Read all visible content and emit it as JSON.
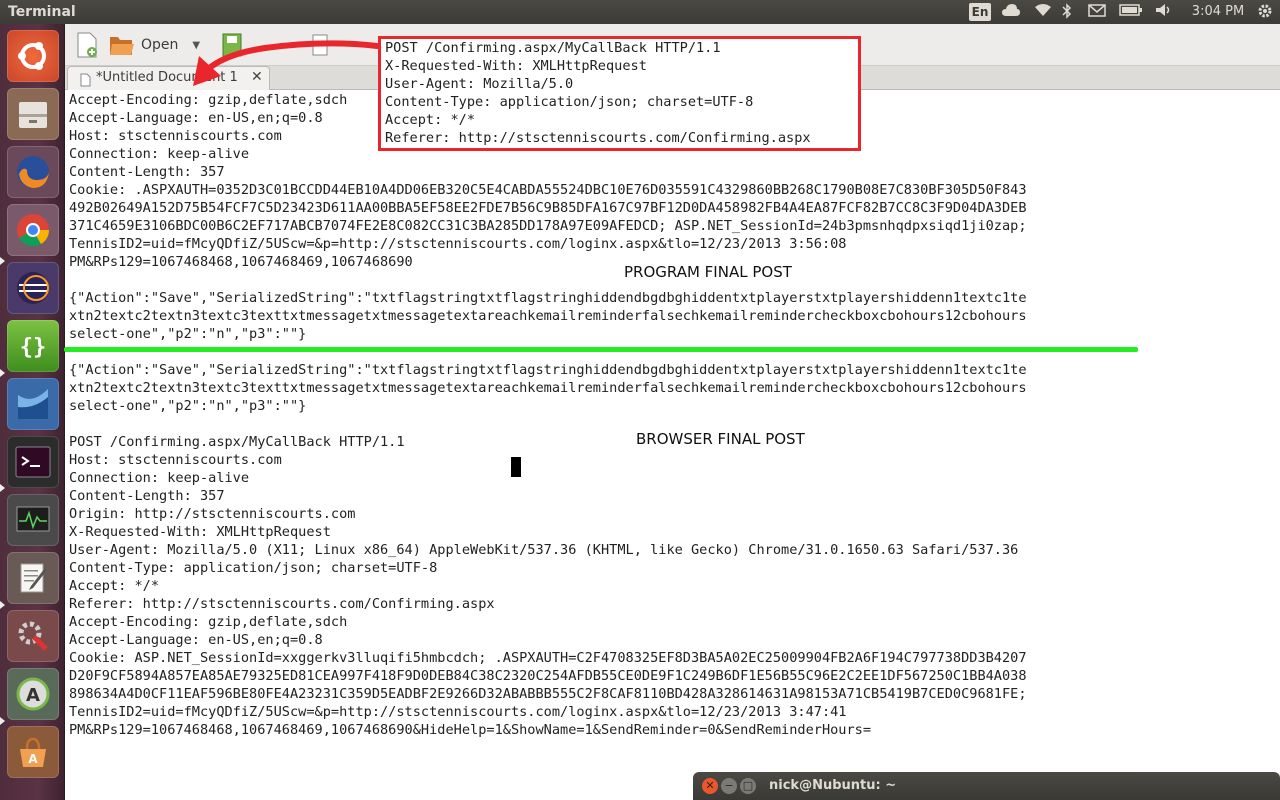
{
  "top_panel": {
    "app_title": "Terminal",
    "keyboard_indicator": "En",
    "clock": "3:04 PM",
    "icons": [
      "cloud-icon",
      "wifi-icon",
      "bluetooth-icon",
      "mail-icon",
      "battery-icon",
      "volume-icon",
      "gear-icon"
    ]
  },
  "launcher": {
    "items": [
      "ubuntu-dash",
      "file-manager",
      "firefox",
      "chrome",
      "eclipse",
      "brackets",
      "mysql-workbench",
      "terminal",
      "system-monitor",
      "text-editor",
      "system-settings",
      "software-updater",
      "software-center"
    ]
  },
  "gedit": {
    "toolbar": {
      "open_label": "Open"
    },
    "tab": {
      "label": "*Untitled Document 1",
      "close": "✕"
    }
  },
  "editor": {
    "lines": [
      "Accept-Encoding: gzip,deflate,sdch",
      "Accept-Language: en-US,en;q=0.8",
      "Host: stsctenniscourts.com",
      "Connection: keep-alive",
      "Content-Length: 357",
      "Cookie: .ASPXAUTH=0352D3C01BCCDD44EB10A4DD06EB320C5E4CABDA55524DBC10E76D035591C4329860BB268C1790B08E7C830BF305D50F843",
      "492B02649A152D75B54FCF7C5D23423D611AA00BBA5EF58EE2FDE7B56C9B85DFA167C97BF12D0DA458982FB4A4EA87FCF82B7CC8C3F9D04DA3DEB",
      "371C4659E3106BDC00B6C2EF717ABCB7074FE2E8C082CC31C3BA285DD178A97E09AFEDCD; ASP.NET_SessionId=24b3pmsnhqdpxsiqd1ji0zap;",
      "TennisID2=uid=fMcyQDfiZ/5UScw=&p=http://stsctenniscourts.com/loginx.aspx&tlo=12/23/2013 3:56:08",
      "PM&RPs129=1067468468,1067468469,1067468690",
      "",
      "{\"Action\":\"Save\",\"SerializedString\":\"txtflagstringtxtflagstringhiddendbgdbghiddentxtplayerstxtplayershiddenn1textc1te",
      "xtn2textc2textn3textc3texttxtmessagetxtmessagetextareachkemailreminderfalsechkemailremindercheckboxcbohours12cbohours",
      "select-one\",\"p2\":\"n\",\"p3\":\"\"}",
      "",
      "{\"Action\":\"Save\",\"SerializedString\":\"txtflagstringtxtflagstringhiddendbgdbghiddentxtplayerstxtplayershiddenn1textc1te",
      "xtn2textc2textn3textc3texttxtmessagetxtmessagetextareachkemailreminderfalsechkemailremindercheckboxcbohours12cbohours",
      "select-one\",\"p2\":\"n\",\"p3\":\"\"}",
      "",
      "POST /Confirming.aspx/MyCallBack HTTP/1.1",
      "Host: stsctenniscourts.com",
      "Connection: keep-alive",
      "Content-Length: 357",
      "Origin: http://stsctenniscourts.com",
      "X-Requested-With: XMLHttpRequest",
      "User-Agent: Mozilla/5.0 (X11; Linux x86_64) AppleWebKit/537.36 (KHTML, like Gecko) Chrome/31.0.1650.63 Safari/537.36",
      "Content-Type: application/json; charset=UTF-8",
      "Accept: */*",
      "Referer: http://stsctenniscourts.com/Confirming.aspx",
      "Accept-Encoding: gzip,deflate,sdch",
      "Accept-Language: en-US,en;q=0.8",
      "Cookie: ASP.NET_SessionId=xxggerkv3lluqifi5hmbcdch; .ASPXAUTH=C2F4708325EF8D3BA5A02EC25009904FB2A6F194C797738DD3B4207",
      "D20F9CF5894A857EA85AE79325ED81CEA997F418F9D0DEB84C38C2320C254AFDB55CE0DE9F1C249B6DF1E56B55C96E2C2EE1DF567250C1BB4A038",
      "898634A4D0CF11EAF596BE80FE4A23231C359D5EADBF2E9266D32ABABBB555C2F8CAF8110BD428A328614631A98153A71CB5419B7CED0C9681FE;",
      "TennisID2=uid=fMcyQDfiZ/5UScw=&p=http://stsctenniscourts.com/loginx.aspx&tlo=12/23/2013 3:47:41",
      "PM&RPs129=1067468468,1067468469,1067468690&HideHelp=1&ShowName=1&SendReminder=0&SendReminderHours="
    ],
    "program_label": "PROGRAM FINAL POST",
    "browser_label": "BROWSER FINAL POST"
  },
  "callout": {
    "lines": [
      "POST /Confirming.aspx/MyCallBack HTTP/1.1",
      "X-Requested-With: XMLHttpRequest",
      "User-Agent: Mozilla/5.0",
      "Content-Type: application/json; charset=UTF-8",
      "Accept: */*",
      "Referer: http://stsctenniscourts.com/Confirming.aspx"
    ],
    "border_color": "#e8262c"
  },
  "taskbar": {
    "terminal_title": "nick@Nubuntu: ~",
    "close": "✕",
    "minimize": "−",
    "maximize": "□"
  },
  "colors": {
    "launcher": "#5a3344",
    "panel": "#3c3b37",
    "annotation_red": "#e8262c",
    "annotation_green": "#22ee22"
  }
}
